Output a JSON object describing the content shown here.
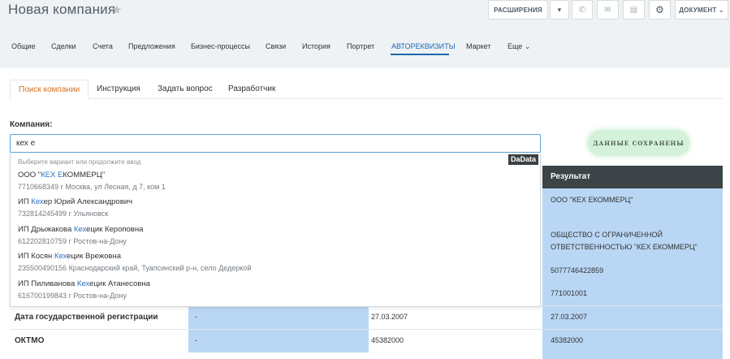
{
  "header": {
    "title": "Новая компания",
    "star_icon": "★",
    "extensions_label": "РАСШИРЕНИЯ",
    "caret": "▾",
    "phone_icon": "✆",
    "mail_icon": "✉",
    "chat_icon": "▤",
    "gear_icon": "⚙",
    "document_label": "ДОКУМЕНТ ⌄"
  },
  "nav": {
    "tabs": [
      "Общие",
      "Сделки",
      "Счета",
      "Предложения",
      "Бизнес-процессы",
      "Связи",
      "История",
      "Портрет",
      "АВТОРЕКВИЗИТЫ",
      "Маркет",
      "Еще ⌄"
    ]
  },
  "subtabs": [
    "Поиск компании",
    "Инструкция",
    "Задать вопрос",
    "Разработчик"
  ],
  "form": {
    "company_label": "Компания:",
    "company_value": "кех е"
  },
  "saved_badge": "ДАННЫЕ СОХРАНЕНЫ",
  "dropdown": {
    "hint": "Выберите вариант или продолжите ввод",
    "provider": "DaData",
    "items": [
      {
        "pre": "ООО \"",
        "hl": "КЕХ Е",
        "post": "КОММЕРЦ\"",
        "address": "7710668349  г Москва, ул Лесная, д 7, ком 1"
      },
      {
        "pre": "ИП ",
        "hl": "Кех",
        "post": "ер Юрий Александрович",
        "address": "732814245499  г Ульяновск"
      },
      {
        "pre": "ИП Дрыжакова ",
        "hl": "Кех",
        "post": "ецик Кероповна",
        "address": "612202810759  г Ростов-на-Дону"
      },
      {
        "pre": "ИП Косян ",
        "hl": "Кех",
        "post": "ецик Врежовна",
        "address": "235500490156  Краснодарский край, Туапсинский р-н, село Дедеркой"
      },
      {
        "pre": "ИП Пиливанова ",
        "hl": "Кех",
        "post": "ецик Атанесовна",
        "address": "616700199843  г Ростов-на-Дону"
      }
    ]
  },
  "result": {
    "header": "Результат",
    "cells": [
      "ООО \"КЕХ ЕКОММЕРЦ\"",
      "ОБЩЕСТВО С ОГРАНИЧЕННОЙ ОТВЕТСТВЕННОСТЬЮ \"КЕХ ЕКОММЕРЦ\"",
      "5077746422859",
      "771001001"
    ]
  },
  "rows": [
    {
      "label": "Дата государственной регистрации",
      "current": "-",
      "found": "27.03.2007",
      "result": "27.03.2007"
    },
    {
      "label": "ОКТМО",
      "current": "-",
      "found": "45382000",
      "result": "45382000"
    }
  ]
}
